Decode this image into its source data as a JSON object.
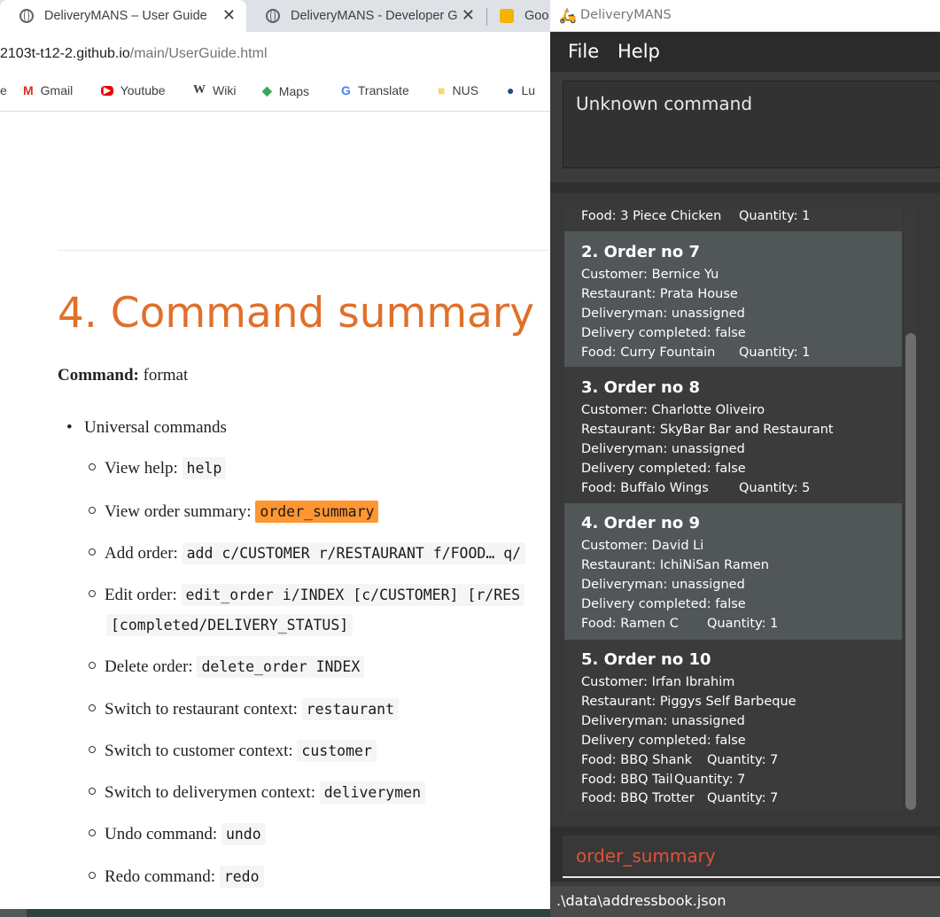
{
  "browser": {
    "tabs": [
      {
        "title": "DeliveryMANS – User Guide",
        "close": "✕"
      },
      {
        "title": "DeliveryMANS - Developer G",
        "close": "✕"
      },
      {
        "title": "Goo"
      }
    ],
    "url_host": "2103t-t12-2.github.io",
    "url_path": "/main/UserGuide.html",
    "bookmarks": [
      {
        "label": "e"
      },
      {
        "label": "Gmail",
        "icon": "M"
      },
      {
        "label": "Youtube",
        "icon": "▶"
      },
      {
        "label": "Wiki",
        "icon": "W"
      },
      {
        "label": "Maps",
        "icon": "◆"
      },
      {
        "label": "Translate",
        "icon": "G"
      },
      {
        "label": "NUS",
        "icon": "■"
      },
      {
        "label": "Lu",
        "icon": "●"
      }
    ]
  },
  "page": {
    "heading": "4. Command summary",
    "command_label": "Command:",
    "command_format": "format",
    "list_heading": "Universal commands",
    "items": [
      {
        "label": "View help:",
        "code": "help"
      },
      {
        "label": "View order summary:",
        "code": "order_summary"
      },
      {
        "label": "Add order:",
        "code": "add c/CUSTOMER r/RESTAURANT f/FOOD… q/"
      },
      {
        "label": "Edit order:",
        "code": "edit_order i/INDEX [c/CUSTOMER] [r/RES"
      },
      {
        "label": "Delete order:",
        "code": "delete_order INDEX"
      },
      {
        "label": "Switch to restaurant context:",
        "code": "restaurant"
      },
      {
        "label": "Switch to customer context:",
        "code": "customer"
      },
      {
        "label": "Switch to deliverymen context:",
        "code": "deliverymen"
      },
      {
        "label": "Undo command:",
        "code": "undo"
      },
      {
        "label": "Redo command:",
        "code": "redo"
      }
    ],
    "edit_continuation": "[completed/DELIVERY_STATUS]"
  },
  "app": {
    "title": "DeliveryMANS",
    "menu": {
      "file": "File",
      "help": "Help"
    },
    "result": "Unknown command",
    "partial_card": {
      "food": "Food: 3 Piece Chicken",
      "qty": "Quantity: 1"
    },
    "orders": [
      {
        "header": "2.  Order no 7",
        "customer": "Customer: Bernice Yu",
        "restaurant": "Restaurant: Prata House",
        "deliveryman": "Deliveryman: unassigned",
        "completed": "Delivery completed: false",
        "foods": [
          {
            "food": "Food: Curry Fountain",
            "qty": "Quantity: 1"
          }
        ]
      },
      {
        "header": "3.  Order no 8",
        "customer": "Customer: Charlotte Oliveiro",
        "restaurant": "Restaurant: SkyBar Bar and Restaurant",
        "deliveryman": "Deliveryman: unassigned",
        "completed": "Delivery completed: false",
        "foods": [
          {
            "food": "Food: Buffalo Wings",
            "qty": "Quantity: 5"
          }
        ]
      },
      {
        "header": "4.  Order no 9",
        "customer": "Customer: David Li",
        "restaurant": "Restaurant: IchiNiSan Ramen",
        "deliveryman": "Deliveryman: unassigned",
        "completed": "Delivery completed: false",
        "foods": [
          {
            "food": "Food: Ramen C",
            "qty": "Quantity: 1"
          }
        ]
      },
      {
        "header": "5.  Order no 10",
        "customer": "Customer: Irfan Ibrahim",
        "restaurant": "Restaurant: Piggys Self Barbeque",
        "deliveryman": "Deliveryman: unassigned",
        "completed": "Delivery completed: false",
        "foods": [
          {
            "food": "Food: BBQ Shank",
            "qty": "Quantity: 7"
          },
          {
            "food": "Food: BBQ Tail",
            "qty": "Quantity: 7"
          },
          {
            "food": "Food: BBQ Trotter",
            "qty": "Quantity: 7"
          }
        ]
      }
    ],
    "command_input": "order_summary",
    "status": ".\\data\\addressbook.json"
  }
}
